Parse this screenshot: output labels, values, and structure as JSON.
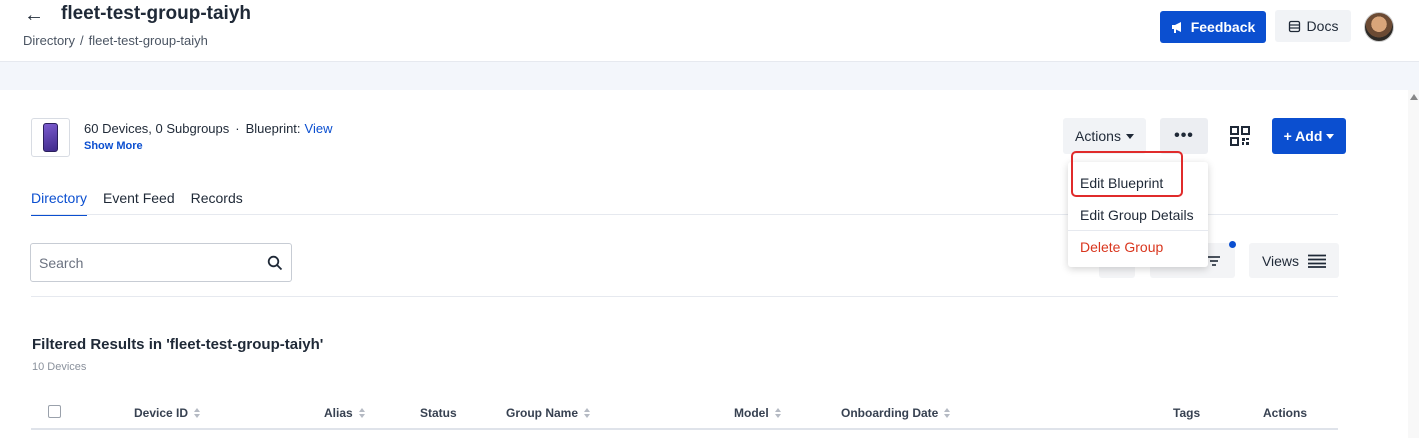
{
  "header": {
    "title": "fleet-test-group-taiyh",
    "breadcrumb": [
      "Directory",
      "fleet-test-group-taiyh"
    ],
    "breadcrumb_separator": "/",
    "feedback_label": "Feedback",
    "docs_label": "Docs",
    "accent_color": "#0b4fd0"
  },
  "group": {
    "summary": "60 Devices, 0 Subgroups",
    "blueprint_label": "Blueprint:",
    "blueprint_link": "View",
    "show_more": "Show More"
  },
  "toolbar": {
    "actions_label": "Actions",
    "more_label": "•••",
    "add_label": "+ Add"
  },
  "actions_menu": {
    "items": [
      "Edit Blueprint",
      "Edit Group Details",
      "Delete Group"
    ],
    "destructive_color": "#d9361e",
    "highlight_color": "#e02b2b"
  },
  "tabs": [
    {
      "label": "Directory",
      "active": true
    },
    {
      "label": "Event Feed",
      "active": false
    },
    {
      "label": "Records",
      "active": false
    }
  ],
  "search": {
    "placeholder": "Search"
  },
  "views_label": "Views",
  "results": {
    "title": "Filtered Results in 'fleet-test-group-taiyh'",
    "count": "10 Devices"
  },
  "table": {
    "columns": [
      "Device ID",
      "Alias",
      "Status",
      "Group Name",
      "Model",
      "Onboarding Date",
      "Tags",
      "Actions"
    ]
  }
}
